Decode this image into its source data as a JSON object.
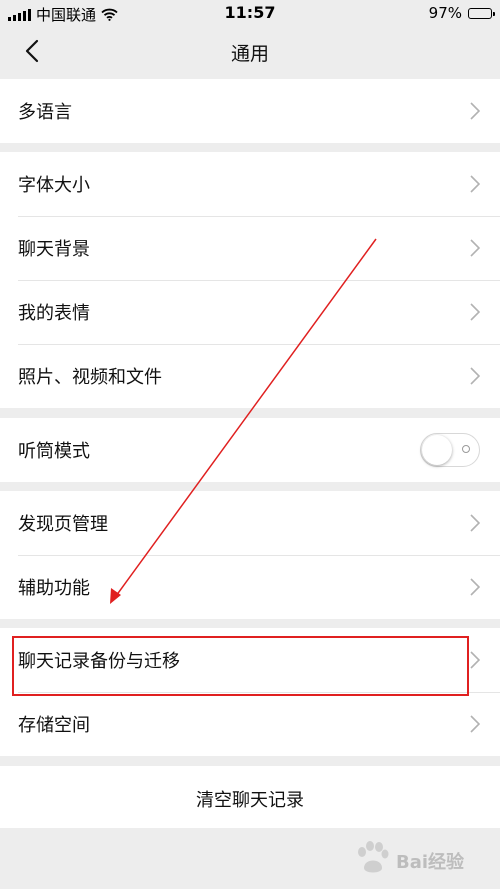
{
  "status_bar": {
    "carrier": "中国联通",
    "time": "11:57",
    "battery": "97%",
    "battery_level": 0.97
  },
  "nav": {
    "title": "通用",
    "back_icon": "chevron-left-icon"
  },
  "groups": [
    {
      "items": [
        {
          "label": "多语言",
          "type": "chevron"
        }
      ]
    },
    {
      "items": [
        {
          "label": "字体大小",
          "type": "chevron"
        },
        {
          "label": "聊天背景",
          "type": "chevron"
        },
        {
          "label": "我的表情",
          "type": "chevron"
        },
        {
          "label": "照片、视频和文件",
          "type": "chevron"
        }
      ]
    },
    {
      "items": [
        {
          "label": "听筒模式",
          "type": "toggle",
          "on": false
        }
      ]
    },
    {
      "items": [
        {
          "label": "发现页管理",
          "type": "chevron"
        },
        {
          "label": "辅助功能",
          "type": "chevron"
        }
      ]
    },
    {
      "items": [
        {
          "label": "聊天记录备份与迁移",
          "type": "chevron",
          "highlighted": true
        },
        {
          "label": "存储空间",
          "type": "chevron"
        }
      ]
    }
  ],
  "clear_button": {
    "label": "清空聊天记录"
  },
  "annotation": {
    "color": "#e02020"
  },
  "watermark": {
    "text": "Bai经验"
  }
}
